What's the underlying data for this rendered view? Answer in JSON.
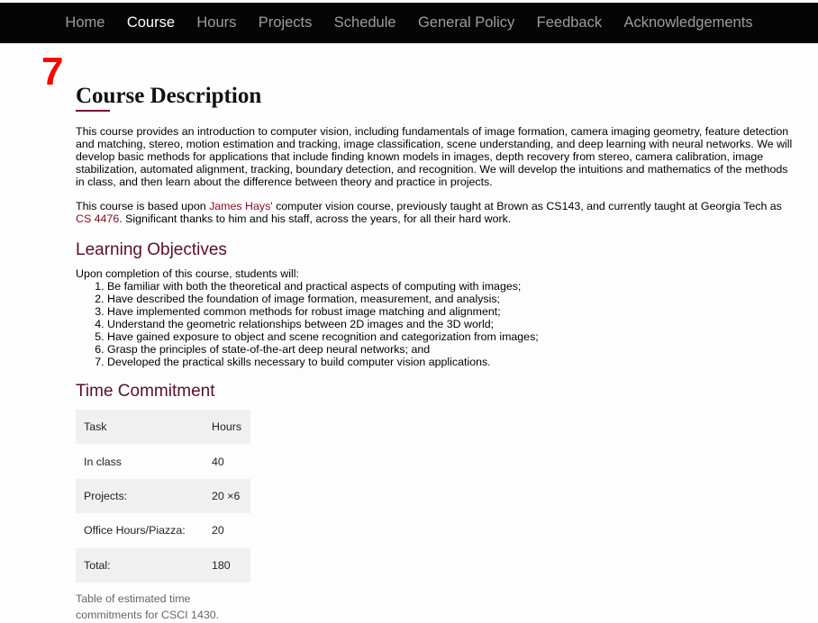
{
  "nav": {
    "items": [
      {
        "label": "Home",
        "active": false
      },
      {
        "label": "Course",
        "active": true
      },
      {
        "label": "Hours",
        "active": false
      },
      {
        "label": "Projects",
        "active": false
      },
      {
        "label": "Schedule",
        "active": false
      },
      {
        "label": "General Policy",
        "active": false
      },
      {
        "label": "Feedback",
        "active": false
      },
      {
        "label": "Acknowledgements",
        "active": false
      }
    ]
  },
  "badge": "7",
  "course_description": {
    "title": "Course Description",
    "para1": "This course provides an introduction to computer vision, including fundamentals of image formation, camera imaging geometry, feature detection and matching, stereo, motion estimation and tracking, image classification, scene understanding, and deep learning with neural networks. We will develop basic methods for applications that include finding known models in images, depth recovery from stereo, camera calibration, image stabilization, automated alignment, tracking, boundary detection, and recognition. We will develop the intuitions and mathematics of the methods in class, and then learn about the difference between theory and practice in projects.",
    "para2_prefix": "This course is based upon ",
    "para2_link1": "James Hays'",
    "para2_middle": " computer vision course, previously taught at Brown as CS143, and currently taught at Georgia Tech as ",
    "para2_link2": "CS 4476",
    "para2_suffix": ". Significant thanks to him and his staff, across the years, for all their hard work."
  },
  "learning_objectives": {
    "title": "Learning Objectives",
    "intro": "Upon completion of this course, students will:",
    "items": [
      "Be familiar with both the theoretical and practical aspects of computing with images;",
      "Have described the foundation of image formation, measurement, and analysis;",
      "Have implemented common methods for robust image matching and alignment;",
      "Understand the geometric relationships between 2D images and the 3D world;",
      "Have gained exposure to object and scene recognition and categorization from images;",
      "Grasp the principles of state-of-the-art deep neural networks; and",
      "Developed the practical skills necessary to build computer vision applications."
    ]
  },
  "time_commitment": {
    "title": "Time Commitment",
    "headers": [
      "Task",
      "Hours"
    ],
    "rows": [
      [
        "In class",
        "40"
      ],
      [
        "Projects:",
        "20 ×6"
      ],
      [
        "Office Hours/Piazza:",
        "20"
      ],
      [
        "Total:",
        "180"
      ]
    ],
    "caption": "Table of estimated time commitments for CSCI 1430."
  },
  "colors": {
    "nav_bg": "#050505",
    "nav_text": "#9d9d9d",
    "nav_active": "#ffffff",
    "badge": "#ff0000",
    "subhead": "#5b0f2a",
    "link": "#8b1025",
    "table_shade": "#f0f0f0"
  }
}
